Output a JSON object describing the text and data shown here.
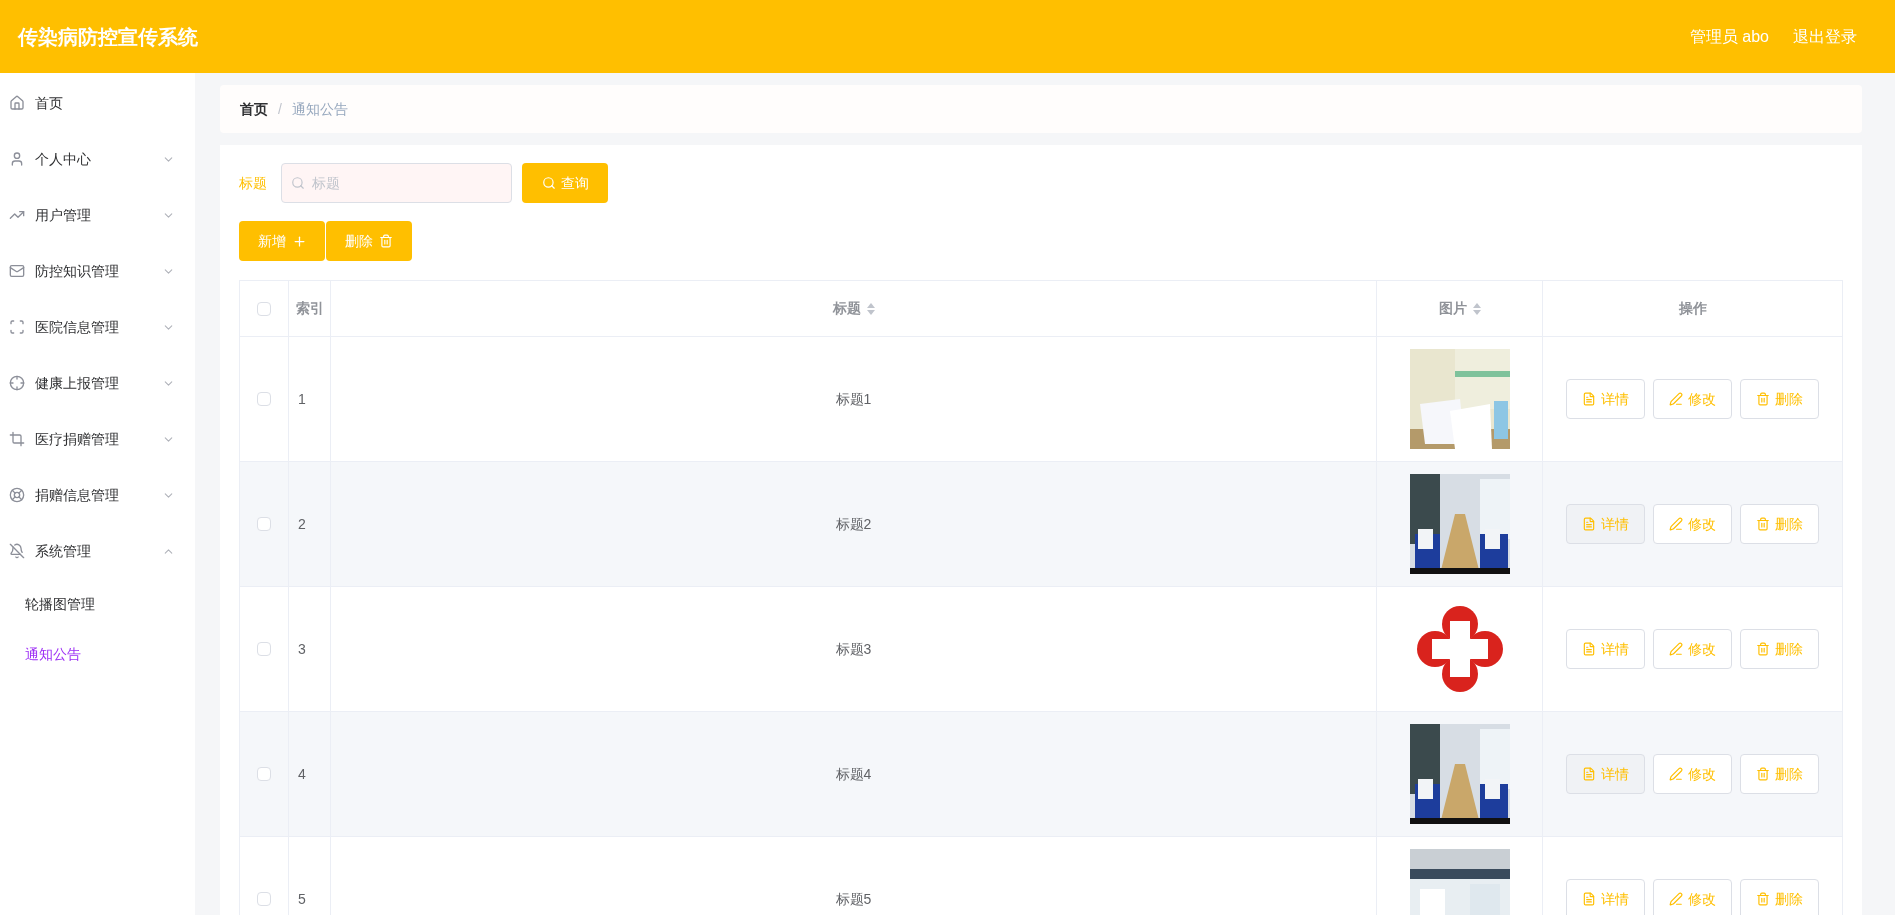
{
  "header": {
    "title": "传染病防控宣传系统",
    "user": "管理员 abo",
    "logout": "退出登录"
  },
  "sidebar": {
    "items": [
      {
        "label": "首页"
      },
      {
        "label": "个人中心",
        "expanded": false
      },
      {
        "label": "用户管理",
        "expanded": false
      },
      {
        "label": "防控知识管理",
        "expanded": false
      },
      {
        "label": "医院信息管理",
        "expanded": false
      },
      {
        "label": "健康上报管理",
        "expanded": false
      },
      {
        "label": "医疗捐赠管理",
        "expanded": false
      },
      {
        "label": "捐赠信息管理",
        "expanded": false
      },
      {
        "label": "系统管理",
        "expanded": true,
        "children": [
          {
            "label": "轮播图管理",
            "selected": false
          },
          {
            "label": "通知公告",
            "selected": true
          }
        ]
      }
    ]
  },
  "breadcrumb": {
    "items": [
      "首页",
      "通知公告"
    ],
    "separator": "/"
  },
  "search": {
    "label": "标题",
    "placeholder": "标题",
    "button": "查询"
  },
  "actions": [
    "新增",
    "删除"
  ],
  "table": {
    "columns": [
      "索引",
      "标题",
      "图片",
      "操作"
    ],
    "all_checked": false,
    "rows": [
      {
        "checked": false,
        "index": "1",
        "title": "标题1",
        "image": {
          "kind": "picture"
        },
        "buttons": [
          "详情",
          "修改",
          "删除"
        ]
      },
      {
        "checked": false,
        "index": "2",
        "title": "标题2",
        "image": {
          "kind": "picture"
        },
        "buttons": [
          "详情",
          "修改",
          "删除"
        ]
      },
      {
        "checked": false,
        "index": "3",
        "title": "标题3",
        "image": {
          "kind": "picture"
        },
        "buttons": [
          "详情",
          "修改",
          "删除"
        ]
      },
      {
        "checked": false,
        "index": "4",
        "title": "标题4",
        "image": {
          "kind": "picture"
        },
        "buttons": [
          "详情",
          "修改",
          "删除"
        ]
      },
      {
        "checked": false,
        "index": "5",
        "title": "标题5",
        "image": {
          "kind": "picture"
        },
        "buttons": [
          "详情",
          "修改",
          "删除"
        ]
      }
    ]
  }
}
